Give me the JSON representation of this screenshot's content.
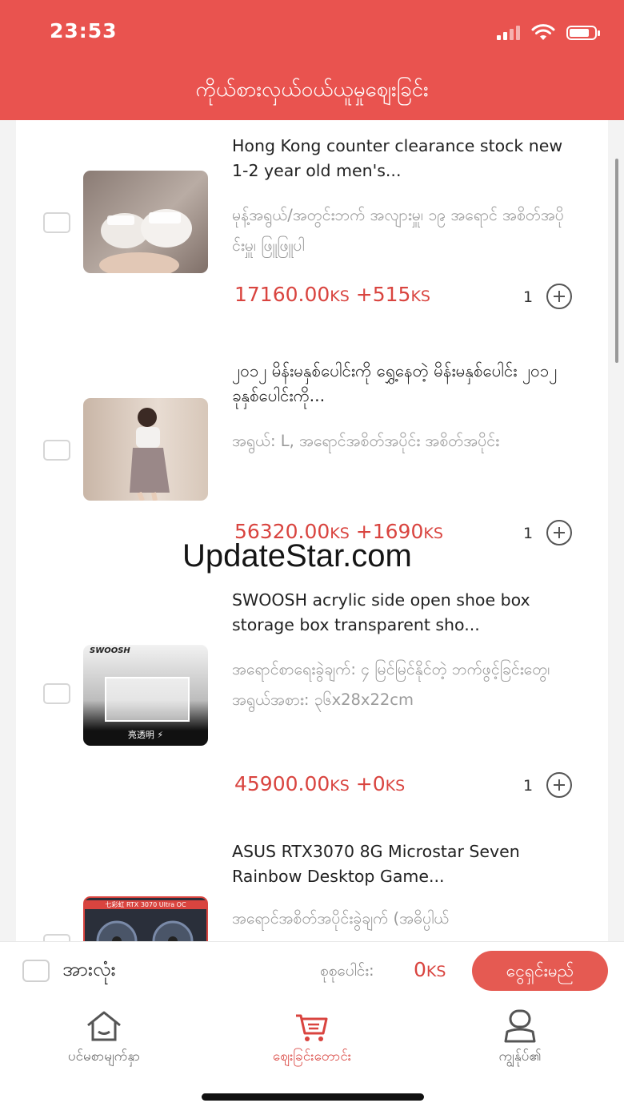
{
  "status_bar": {
    "time": "23:53"
  },
  "header": {
    "title": "ကိုယ်စားလှယ်ဝယ်ယူမှုဈေးခြင်း"
  },
  "items": [
    {
      "title": "Hong Kong counter clearance stock new 1-2 year old men's...",
      "attributes": "မုန့်အရွယ်/အတွင်းဘက် အလျားမှူ၊ ၁၉ အရောင် အစိတ်အပိုင်းမှူ၊ ဖြူဖြူပါ",
      "price": "17160.00",
      "shipping": "+515",
      "currency": "KS",
      "quantity": "1"
    },
    {
      "title": "၂၀၁၂ မိန်းမနှစ်ပေါင်းကို ရွှေ့နေတဲ့ မိန်းမနှစ်ပေါင်း ၂၀၁၂ ခုနှစ်ပေါင်းကို...",
      "attributes": "အရွယ်: L, အရောင်အစိတ်အပိုင်း အစိတ်အပိုင်း",
      "price": "56320.00",
      "shipping": "+1690",
      "currency": "KS",
      "quantity": "1"
    },
    {
      "title": "SWOOSH acrylic side open shoe box storage box transparent sho...",
      "attributes": "အရောင်စာရေးခွဲချက်: ၄ မြင်မြင်နိုင်တဲ့ ဘက်ဖွင့်ခြင်းတွေ၊ အရွယ်အစား: ၃၆x28x22cm",
      "price": "45900.00",
      "shipping": "+0",
      "currency": "KS",
      "quantity": "1",
      "thumb_text": "亮透明 ⚡",
      "thumb_brand": "SWOOSH"
    },
    {
      "title": "ASUS RTX3070 8G Microstar Seven Rainbow Desktop Game...",
      "attributes": "အရောင်အစိတ်အပိုင်းခွဲချက် (အဓိပ္ပါယ်",
      "thumb_text": "七彩虹 RTX 3070 Ultra OC"
    }
  ],
  "watermark": "UpdateStar.com",
  "footer": {
    "select_all": "အားလုံး",
    "total_label": "စုစုပေါင်း:",
    "total_value": "0",
    "total_currency": "KS",
    "checkout": "ငွေရှင်းမည်"
  },
  "tabs": [
    {
      "label": "ပင်မစာမျက်နှာ",
      "icon": "home-icon",
      "active": false
    },
    {
      "label": "ဈေးခြင်းတောင်း",
      "icon": "cart-icon",
      "active": true
    },
    {
      "label": "ကျွန်ုပ်၏",
      "icon": "profile-icon",
      "active": false
    }
  ],
  "colors": {
    "accent": "#e9534f",
    "price": "#d9443f",
    "checkout": "#e55a52"
  }
}
